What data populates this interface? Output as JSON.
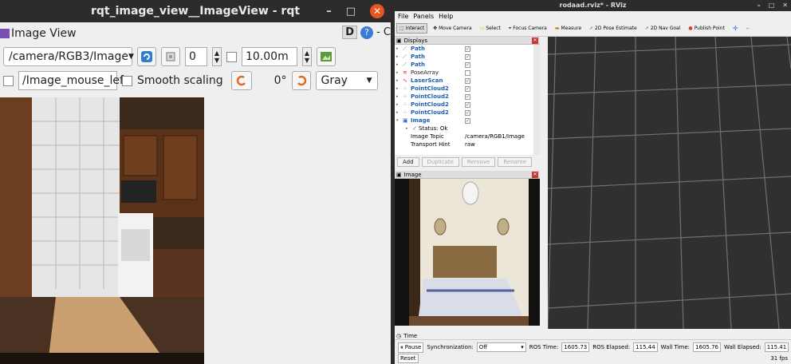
{
  "rqt": {
    "window_title": "rqt_image_view__ImageView - rqt",
    "plugin_title": "Image View",
    "d_label": "D",
    "help_label": "?",
    "dash_label": "- C",
    "topic": "/camera/RGB3/Image",
    "frame_value": "0",
    "distance_value": "10.00m",
    "mouse_topic": "/Image_mouse_left",
    "smooth_label": "Smooth scaling",
    "rotation_label": "0°",
    "colormap": "Gray",
    "min_glyph": "–",
    "max_glyph": "□",
    "close_glyph": "✕"
  },
  "rviz": {
    "window_title": "rodaad.rviz* - RViz",
    "menu": [
      "File",
      "Panels",
      "Help"
    ],
    "tools": [
      "Interact",
      "Move Camera",
      "Select",
      "Focus Camera",
      "Measure",
      "2D Pose Estimate",
      "2D Nav Goal",
      "Publish Point"
    ],
    "displays_title": "Displays",
    "displays": [
      {
        "name": "Path",
        "icon": "path-icon",
        "checked": true
      },
      {
        "name": "Path",
        "icon": "path-icon",
        "checked": true
      },
      {
        "name": "Path",
        "icon": "path-icon",
        "checked": true
      },
      {
        "name": "PoseArray",
        "icon": "posearray-icon",
        "checked": false
      },
      {
        "name": "LaserScan",
        "icon": "laserscan-icon",
        "checked": true
      },
      {
        "name": "PointCloud2",
        "icon": "pointcloud-icon",
        "checked": true
      },
      {
        "name": "PointCloud2",
        "icon": "pointcloud-icon",
        "checked": true
      },
      {
        "name": "PointCloud2",
        "icon": "pointcloud-icon",
        "checked": true
      },
      {
        "name": "PointCloud2",
        "icon": "pointcloud-icon",
        "checked": true
      },
      {
        "name": "Image",
        "icon": "image-icon",
        "checked": true
      }
    ],
    "status": "Status: Ok",
    "image_topic_label": "Image Topic",
    "image_topic_value": "/camera/RGB1/Image",
    "transport_label": "Transport Hint",
    "transport_value": "raw",
    "buttons": {
      "add": "Add",
      "duplicate": "Duplicate",
      "remove": "Remove",
      "rename": "Rename"
    },
    "image_panel_title": "Image",
    "time": {
      "title": "Time",
      "pause": "Pause",
      "sync_label": "Synchronization:",
      "sync_value": "Off",
      "ros_time_label": "ROS Time:",
      "ros_time": "1605.73",
      "ros_elapsed_label": "ROS Elapsed:",
      "ros_elapsed": "115.44",
      "wall_time_label": "Wall Time:",
      "wall_time": "1605.76",
      "wall_elapsed_label": "Wall Elapsed:",
      "wall_elapsed": "115.41",
      "reset": "Reset",
      "fps": "31 fps"
    },
    "min_glyph": "–",
    "max_glyph": "□",
    "close_glyph": "✕"
  }
}
